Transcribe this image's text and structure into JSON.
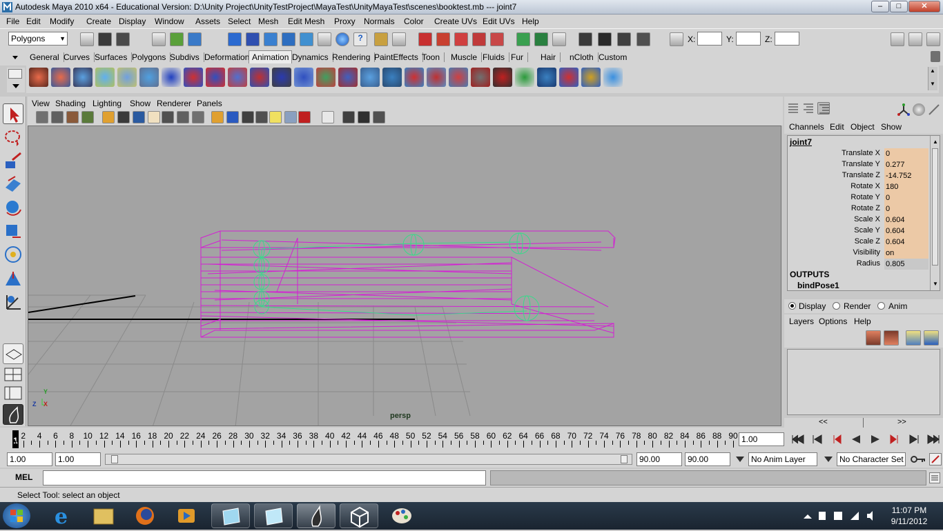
{
  "titlebar": {
    "title": "Autodesk Maya 2010 x64 - Educational Version: D:\\Unity Project\\UnityTestProject\\MayaTest\\UnityMayaTest\\scenes\\booktest.mb   ---   joint7"
  },
  "menubar": {
    "items": [
      "File",
      "Edit",
      "Modify",
      "Create",
      "Display",
      "Window",
      "Assets",
      "Select",
      "Mesh",
      "Edit Mesh",
      "Proxy",
      "Normals",
      "Color",
      "Create UVs",
      "Edit UVs",
      "Help"
    ]
  },
  "statusline": {
    "menu_set": "Polygons",
    "x_label": "X:",
    "y_label": "Y:",
    "z_label": "Z:"
  },
  "shelf_tabs": {
    "items": [
      "General",
      "Curves",
      "Surfaces",
      "Polygons",
      "Subdivs",
      "Deformation",
      "Animation",
      "Dynamics",
      "Rendering",
      "PaintEffects",
      "Toon",
      "Muscle",
      "Fluids",
      "Fur",
      "Hair",
      "nCloth",
      "Custom"
    ],
    "active": "Animation"
  },
  "panel_menu": {
    "items": [
      "View",
      "Shading",
      "Lighting",
      "Show",
      "Renderer",
      "Panels"
    ]
  },
  "viewport": {
    "camera": "persp",
    "axis_x": "X",
    "axis_y": "Y",
    "axis_z": "Z"
  },
  "channel_box": {
    "menu": [
      "Channels",
      "Edit",
      "Object",
      "Show"
    ],
    "node": "joint7",
    "channels": [
      {
        "label": "Translate X",
        "value": "0"
      },
      {
        "label": "Translate Y",
        "value": "0.277"
      },
      {
        "label": "Translate Z",
        "value": "-14.752"
      },
      {
        "label": "Rotate X",
        "value": "180"
      },
      {
        "label": "Rotate Y",
        "value": "0"
      },
      {
        "label": "Rotate Z",
        "value": "0"
      },
      {
        "label": "Scale X",
        "value": "0.604"
      },
      {
        "label": "Scale Y",
        "value": "0.604"
      },
      {
        "label": "Scale Z",
        "value": "0.604"
      },
      {
        "label": "Visibility",
        "value": "on"
      },
      {
        "label": "Radius",
        "value": "0.805"
      }
    ],
    "outputs_label": "OUTPUTS",
    "output_node": "bindPose1"
  },
  "layer_editor": {
    "radio": [
      "Display",
      "Render",
      "Anim"
    ],
    "selected": "Display",
    "menu": [
      "Layers",
      "Options",
      "Help"
    ],
    "nav_left": "<<",
    "nav_right": ">>"
  },
  "time_slider": {
    "labels": [
      "1",
      "2",
      "4",
      "6",
      "8",
      "10",
      "12",
      "14",
      "16",
      "18",
      "20",
      "22",
      "24",
      "26",
      "28",
      "30",
      "32",
      "34",
      "36",
      "38",
      "40",
      "42",
      "44",
      "46",
      "48",
      "50",
      "52",
      "54",
      "56",
      "58",
      "60",
      "62",
      "64",
      "66",
      "68",
      "70",
      "72",
      "74",
      "76",
      "78",
      "80",
      "82",
      "84",
      "86",
      "88",
      "90"
    ],
    "current_time": "1.00"
  },
  "range_slider": {
    "start": "1.00",
    "playback_start": "1.00",
    "playback_end": "90.00",
    "end": "90.00",
    "anim_layer": "No Anim Layer",
    "character_set": "No Character Set"
  },
  "command_line": {
    "label": "MEL"
  },
  "help_line": {
    "text": "Select Tool: select an object"
  },
  "taskbar": {
    "time": "11:07 PM",
    "date": "9/11/2012"
  },
  "colors": {
    "ui_gray": "#d4d4d4",
    "viewport": "#a3a3a3",
    "wireframe": "#d31fd3",
    "joints": "#39d98a",
    "channel_value": "#ecc9a6"
  }
}
